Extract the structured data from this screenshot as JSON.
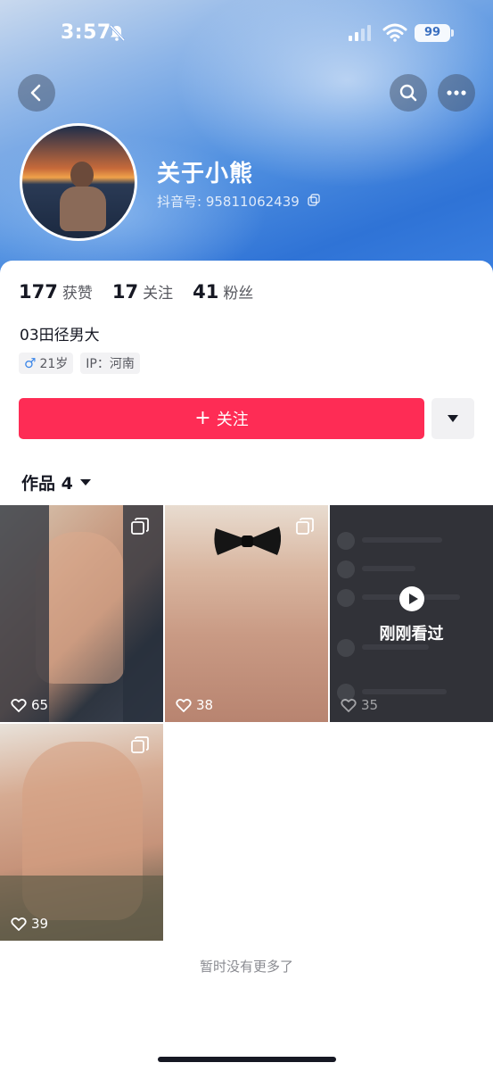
{
  "status_bar": {
    "time": "3:57",
    "battery": "99"
  },
  "profile": {
    "nickname": "关于小熊",
    "douyin_id": "抖音号: 95811062439",
    "stats": [
      {
        "value": "177",
        "label": "获赞"
      },
      {
        "value": "17",
        "label": "关注"
      },
      {
        "value": "41",
        "label": "粉丝"
      }
    ],
    "bio": "03田径男大",
    "tags": {
      "gender_age": "21岁",
      "ip": "IP：河南"
    }
  },
  "actions": {
    "follow_label": "关注"
  },
  "works": {
    "tab_label": "作品 4",
    "items": [
      {
        "likes": "65",
        "multi_image": true
      },
      {
        "likes": "38",
        "multi_image": true
      },
      {
        "likes": "35",
        "watched_label": "刚刚看过"
      },
      {
        "likes": "39",
        "multi_image": true
      }
    ],
    "empty_text": "暂时没有更多了"
  },
  "colors": {
    "accent": "#fe2c55",
    "hero_blue": "#3a7fe0"
  }
}
